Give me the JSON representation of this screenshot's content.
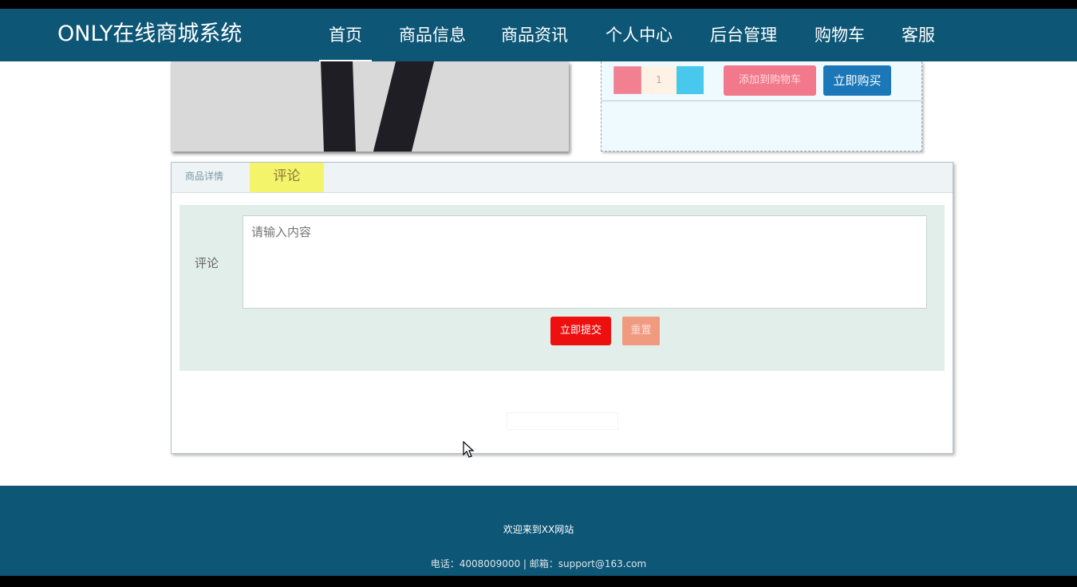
{
  "header": {
    "brand": "ONLY在线商城系统",
    "nav": [
      {
        "label": "首页"
      },
      {
        "label": "商品信息"
      },
      {
        "label": "商品资讯"
      },
      {
        "label": "个人中心"
      },
      {
        "label": "后台管理"
      },
      {
        "label": "购物车"
      },
      {
        "label": "客服"
      }
    ],
    "active_nav": "首页",
    "color": "#0d5676"
  },
  "buy_panel": {
    "quantity": "1",
    "add_to_cart_label": "添加到购物车",
    "buy_now_label": "立即购买"
  },
  "tabs": {
    "items": [
      {
        "label": "商品详情"
      },
      {
        "label": "评论"
      }
    ],
    "active": "评论"
  },
  "comment_form": {
    "label": "评论",
    "placeholder": "请输入内容",
    "submit_label": "立即提交",
    "reset_label": "重置"
  },
  "footer": {
    "welcome": "欢迎来到XX网站",
    "contact": "电话：4008009000 | 邮箱：support@163.com"
  }
}
